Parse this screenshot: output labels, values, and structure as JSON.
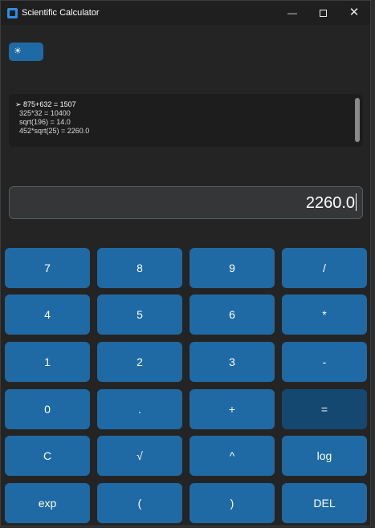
{
  "window": {
    "title": "Scientific Calculator",
    "controls": {
      "minimize": "—",
      "close": "✕"
    }
  },
  "theme_button": {
    "icon": "☀",
    "icon_name": "sun-icon"
  },
  "history": {
    "lines": [
      "➢ 875+632 = 1507",
      "  325*32 = 10400",
      "  sqrt(196) = 14.0",
      "  452*sqrt(25) = 2260.0"
    ]
  },
  "display": {
    "value": "2260.0"
  },
  "keypad": {
    "rows": [
      [
        "7",
        "8",
        "9",
        "/"
      ],
      [
        "4",
        "5",
        "6",
        "*"
      ],
      [
        "1",
        "2",
        "3",
        "-"
      ],
      [
        "0",
        ".",
        "+",
        "="
      ],
      [
        "C",
        "√",
        "^",
        "log"
      ],
      [
        "exp",
        "(",
        ")",
        "DEL"
      ]
    ]
  },
  "colors": {
    "window_bg": "#242424",
    "titlebar_bg": "#1f1f1f",
    "button_blue": "#1f6aa5",
    "button_equals": "#144870",
    "history_bg": "#1d1d1d",
    "display_bg": "#343638",
    "text": "#ffffff"
  }
}
